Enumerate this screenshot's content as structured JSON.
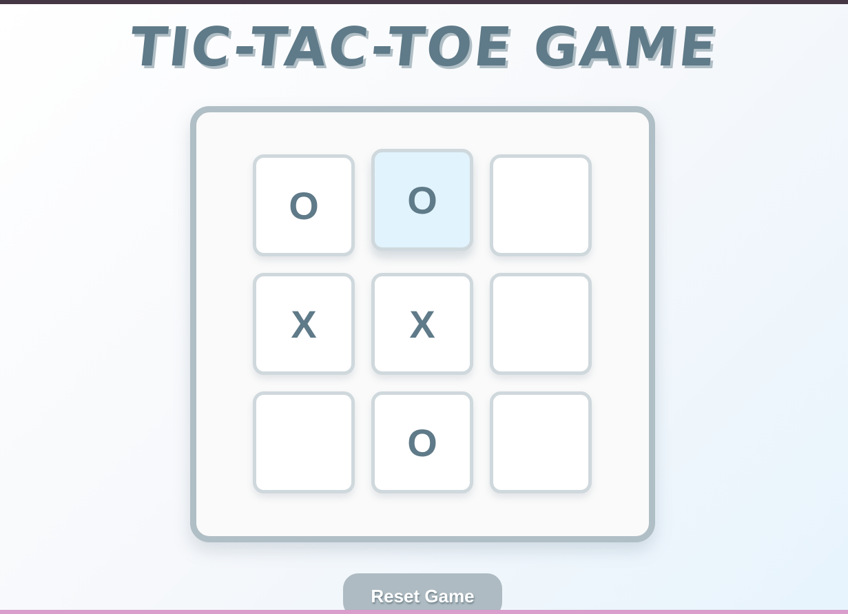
{
  "title": "TIC-TAC-TOE GAME",
  "board": {
    "cells": [
      "O",
      "O",
      "",
      "X",
      "X",
      "",
      "",
      "O",
      ""
    ],
    "hovered_cell_index": 1
  },
  "reset_button": {
    "label": "Reset Game"
  },
  "colors": {
    "mark": "#5f7a88",
    "cell_border": "#cfd8dc",
    "board_border": "#b0bec5",
    "hover_cell": "#e1f3fd",
    "button": "#aebbc2"
  }
}
